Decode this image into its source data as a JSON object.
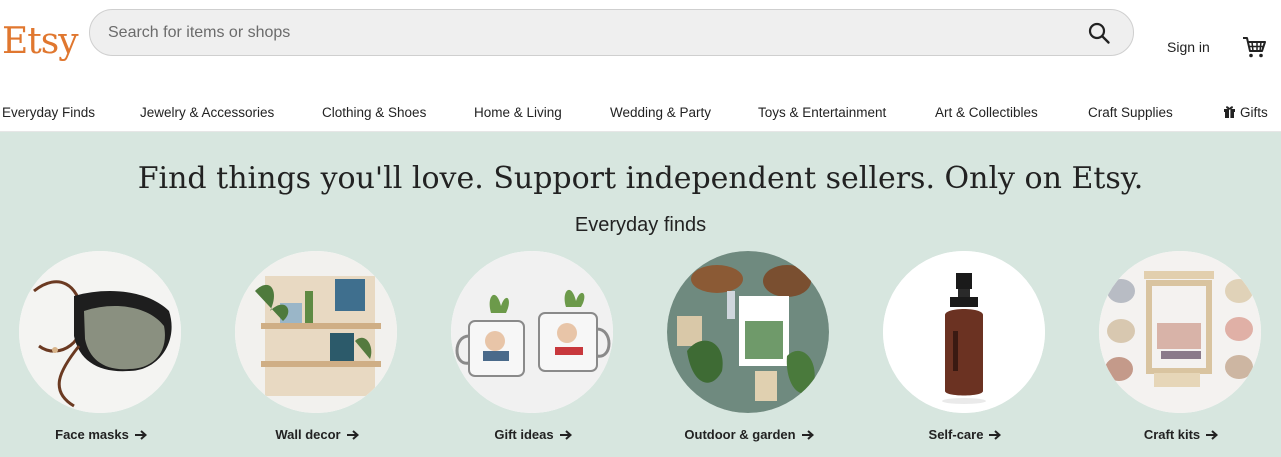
{
  "header": {
    "logo": "Etsy",
    "search_placeholder": "Search for items or shops",
    "sign_in": "Sign in",
    "search_icon": "search-icon",
    "cart_icon": "cart-icon"
  },
  "nav": {
    "items": [
      "Everyday Finds",
      "Jewelry & Accessories",
      "Clothing & Shoes",
      "Home & Living",
      "Wedding & Party",
      "Toys & Entertainment",
      "Art & Collectibles",
      "Craft Supplies",
      "Gifts"
    ],
    "gifts_icon": "gift-icon"
  },
  "hero": {
    "headline": "Find things you'll love. Support independent sellers. Only on Etsy.",
    "subhead": "Everyday finds",
    "categories": [
      {
        "label": "Face masks"
      },
      {
        "label": "Wall decor"
      },
      {
        "label": "Gift ideas"
      },
      {
        "label": "Outdoor & garden"
      },
      {
        "label": "Self-care"
      },
      {
        "label": "Craft kits"
      }
    ]
  },
  "colors": {
    "brand": "#e0772f",
    "hero_bg": "#d7e6df",
    "text": "#222222"
  }
}
